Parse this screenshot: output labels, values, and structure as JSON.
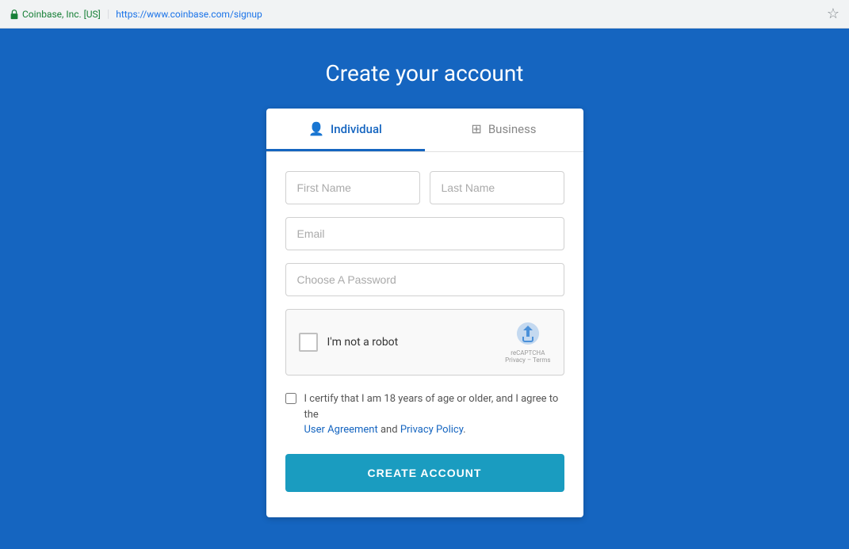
{
  "browser": {
    "security_label": "Coinbase, Inc. [US]",
    "divider": "|",
    "url": "https://www.coinbase.com/signup",
    "star_icon": "☆"
  },
  "page": {
    "title": "Create your account",
    "background_color": "#1565c0"
  },
  "tabs": [
    {
      "id": "individual",
      "label": "Individual",
      "icon": "👤",
      "active": true
    },
    {
      "id": "business",
      "label": "Business",
      "icon": "⊞",
      "active": false
    }
  ],
  "form": {
    "first_name_placeholder": "First Name",
    "last_name_placeholder": "Last Name",
    "email_placeholder": "Email",
    "password_placeholder": "Choose A Password",
    "recaptcha_label": "I'm not a robot",
    "recaptcha_brand": "reCAPTCHA",
    "recaptcha_privacy": "Privacy",
    "recaptcha_terms": "Terms",
    "recaptcha_divider": "–",
    "cert_text_before": "I certify that I am 18 years of age or older, and I agree to the",
    "cert_link1": "User Agreement",
    "cert_and": "and",
    "cert_link2": "Privacy Policy",
    "cert_period": ".",
    "submit_label": "CREATE ACCOUNT"
  }
}
